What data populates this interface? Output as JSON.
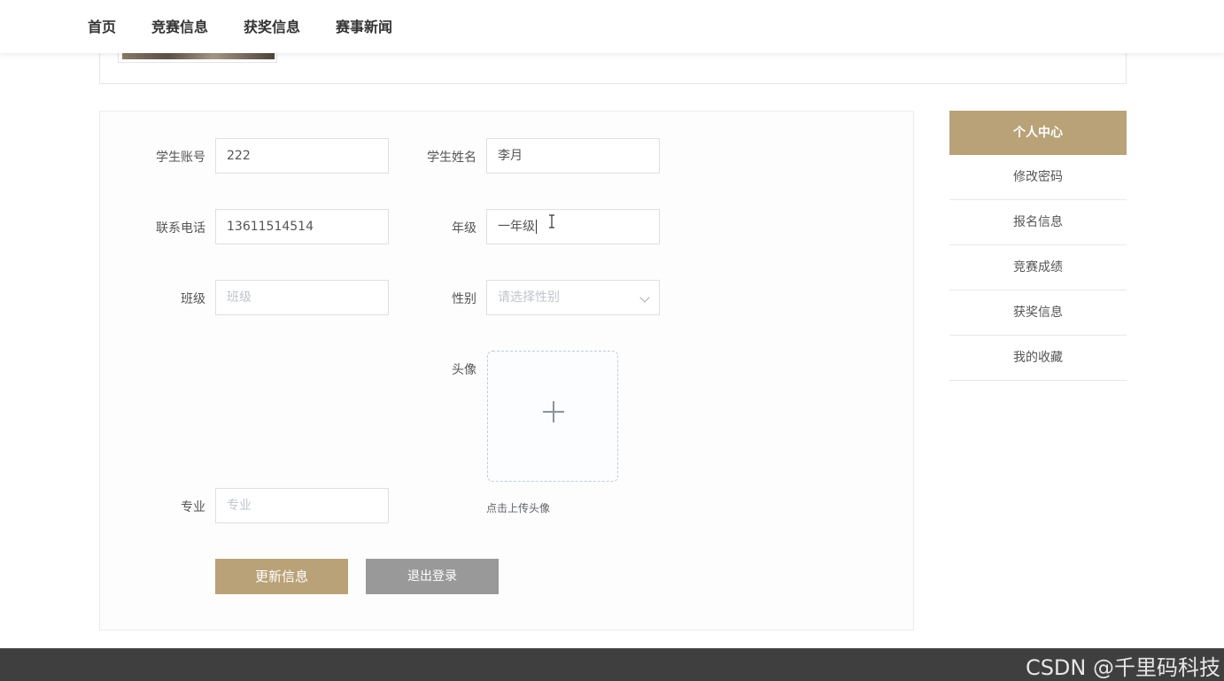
{
  "nav": {
    "items": [
      "首页",
      "竞赛信息",
      "获奖信息",
      "赛事新闻"
    ]
  },
  "form": {
    "account": {
      "label": "学生账号",
      "value": "222"
    },
    "name": {
      "label": "学生姓名",
      "value": "李月"
    },
    "phone": {
      "label": "联系电话",
      "value": "13611514514"
    },
    "grade": {
      "label": "年级",
      "value": "一年级"
    },
    "class": {
      "label": "班级",
      "placeholder": "班级"
    },
    "gender": {
      "label": "性别",
      "placeholder": "请选择性别"
    },
    "avatar": {
      "label": "头像",
      "hint": "点击上传头像"
    },
    "major": {
      "label": "专业",
      "placeholder": "专业"
    },
    "update_button": "更新信息",
    "logout_button": "退出登录"
  },
  "sidebar": {
    "title": "个人中心",
    "items": [
      "修改密码",
      "报名信息",
      "竞赛成绩",
      "获奖信息",
      "我的收藏"
    ]
  },
  "footer": {
    "watermark": "CSDN @千里码科技"
  },
  "colors": {
    "accent": "#b9a277",
    "secondary_button": "#999999",
    "footer": "#3f3f3f"
  }
}
